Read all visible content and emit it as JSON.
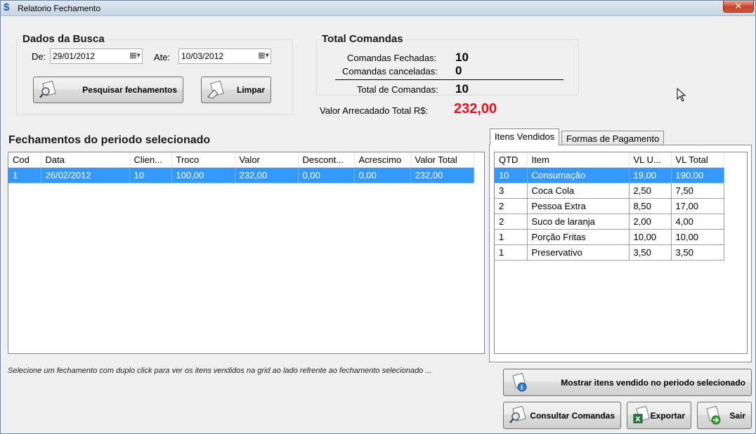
{
  "window": {
    "title": "Relatorio Fechamento",
    "close_label": "✕"
  },
  "busca": {
    "title": "Dados da Busca",
    "de_label": "De:",
    "de_value": "29/01/2012",
    "ate_label": "Ate:",
    "ate_value": "10/03/2012",
    "pesquisar_label": "Pesquisar fechamentos",
    "limpar_label": "Limpar"
  },
  "totais": {
    "title": "Total Comandas",
    "fechadas_label": "Comandas Fechadas:",
    "fechadas_value": "10",
    "canceladas_label": "Comandas canceladas:",
    "canceladas_value": "0",
    "total_label": "Total de Comandas:",
    "total_value": "10",
    "valor_label": "Valor Arrecadado  Total R$:",
    "valor_value": "232,00",
    "valor_color": "#e8101a"
  },
  "fechamentos": {
    "title": "Fechamentos do periodo selecionado",
    "columns": [
      "Cod",
      "Data",
      "Clien...",
      "Troco",
      "Valor",
      "Descont...",
      "Acrescimo",
      "Valor Total"
    ],
    "rows": [
      [
        "1",
        "26/02/2012",
        "10",
        "100,00",
        "232,00",
        "0,00",
        "0,00",
        "232,00"
      ]
    ]
  },
  "tabs": {
    "itens_label": "Itens Vendidos",
    "formas_label": "Formas de Pagamento"
  },
  "itens": {
    "columns": [
      "QTD",
      "Item",
      "VL U...",
      "VL Total"
    ],
    "rows": [
      [
        "10",
        "Consumação",
        "19,00",
        "190,00"
      ],
      [
        "3",
        "Coca Cola",
        "2,50",
        "7,50"
      ],
      [
        "2",
        "Pessoa Extra",
        "8,50",
        "17,00"
      ],
      [
        "2",
        "Suco de laranja",
        "2,00",
        "4,00"
      ],
      [
        "1",
        "Porção Fritas",
        "10,00",
        "10,00"
      ],
      [
        "1",
        "Preservativo",
        "3,50",
        "3,50"
      ]
    ]
  },
  "hint": "Selecione um fechamento com duplo click para ver os itens vendidos na grid ao lado refrente ao fechamento selecionado ...",
  "actions": {
    "mostrar_label": "Mostrar itens vendido no periodo selecionado",
    "consultar_label": "Consultar Comandas",
    "exportar_label": "Exportar",
    "sair_label": "Sair"
  },
  "colors": {
    "selection": "#3399ff"
  }
}
